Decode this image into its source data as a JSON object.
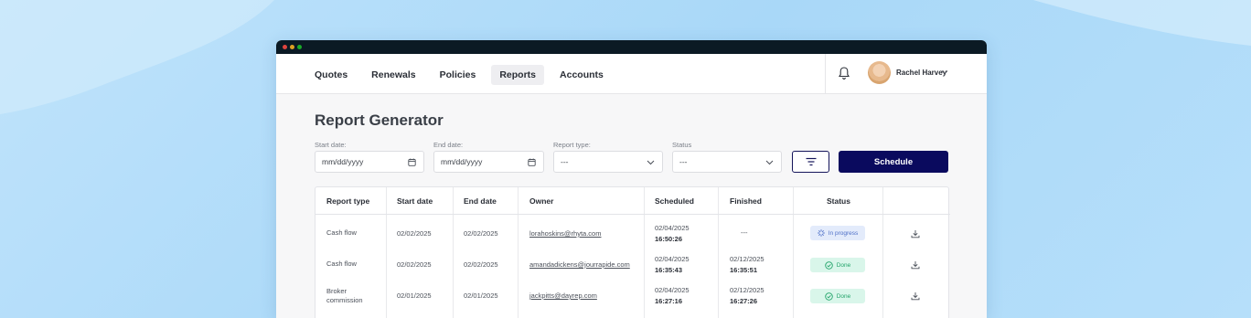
{
  "nav": {
    "links": [
      "Quotes",
      "Renewals",
      "Policies",
      "Reports",
      "Accounts"
    ],
    "active": "Reports",
    "user_name": "Rachel Harvey"
  },
  "page": {
    "title": "Report Generator"
  },
  "filters": {
    "start_label": "Start date:",
    "start_placeholder": "mm/dd/yyyy",
    "end_label": "End date:",
    "end_placeholder": "mm/dd/yyyy",
    "type_label": "Report type:",
    "type_value": "---",
    "status_label": "Status",
    "status_value": "---",
    "schedule_label": "Schedule"
  },
  "table": {
    "headers": [
      "Report type",
      "Start date",
      "End date",
      "Owner",
      "Scheduled",
      "Finished",
      "Status"
    ],
    "rows": [
      {
        "type_line1": "Cash flow",
        "type_line2": "",
        "start": "02/02/2025",
        "end": "02/02/2025",
        "owner": "lorahoskins@rhyta.com",
        "scheduled_date": "02/04/2025",
        "scheduled_time": "16:50:26",
        "finished_date": "---",
        "finished_time": "",
        "status": "In progress",
        "status_kind": "progress"
      },
      {
        "type_line1": "Cash flow",
        "type_line2": "",
        "start": "02/02/2025",
        "end": "02/02/2025",
        "owner": "amandadickens@jourrapide.com",
        "scheduled_date": "02/04/2025",
        "scheduled_time": "16:35:43",
        "finished_date": "02/12/2025",
        "finished_time": "16:35:51",
        "status": "Done",
        "status_kind": "done"
      },
      {
        "type_line1": "Broker",
        "type_line2": "commission",
        "start": "02/01/2025",
        "end": "02/01/2025",
        "owner": "jackpitts@dayrep.com",
        "scheduled_date": "02/04/2025",
        "scheduled_time": "16:27:16",
        "finished_date": "02/12/2025",
        "finished_time": "16:27:26",
        "status": "Done",
        "status_kind": "done"
      }
    ]
  },
  "colors": {
    "primary": "#0a0a5e",
    "progress": "#4d6fc7",
    "done": "#22a46a"
  }
}
